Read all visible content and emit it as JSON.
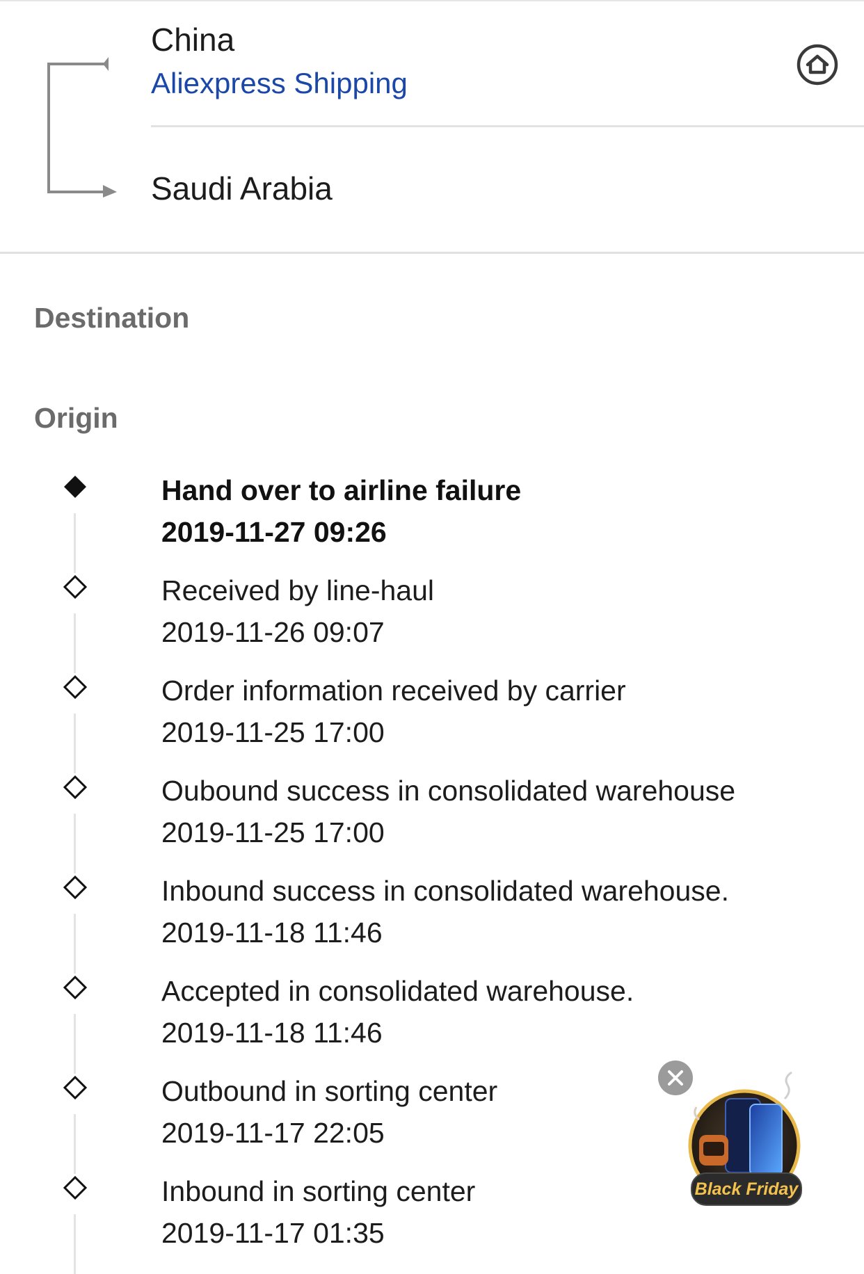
{
  "route": {
    "origin": "China",
    "carrier": "Aliexpress Shipping",
    "destination": "Saudi Arabia"
  },
  "labels": {
    "destination": "Destination",
    "origin": "Origin"
  },
  "events": [
    {
      "title": "Hand over to airline failure",
      "time": "2019-11-27 09:26",
      "current": true
    },
    {
      "title": "Received by line-haul",
      "time": "2019-11-26 09:07",
      "current": false
    },
    {
      "title": "Order information received by carrier",
      "time": "2019-11-25 17:00",
      "current": false
    },
    {
      "title": "Oubound success in consolidated warehouse",
      "time": "2019-11-25 17:00",
      "current": false
    },
    {
      "title": "Inbound success in consolidated warehouse.",
      "time": "2019-11-18 11:46",
      "current": false
    },
    {
      "title": "Accepted in consolidated warehouse.",
      "time": "2019-11-18 11:46",
      "current": false
    },
    {
      "title": "Outbound in sorting center",
      "time": "2019-11-17 22:05",
      "current": false
    },
    {
      "title": "Inbound in sorting center",
      "time": "2019-11-17 01:35",
      "current": false
    }
  ],
  "promo": {
    "badge": "Black Friday",
    "close_icon": "close-icon"
  },
  "colors": {
    "link": "#1b48a8",
    "muted": "#6b6b6b",
    "badge_text": "#f2c14e"
  }
}
